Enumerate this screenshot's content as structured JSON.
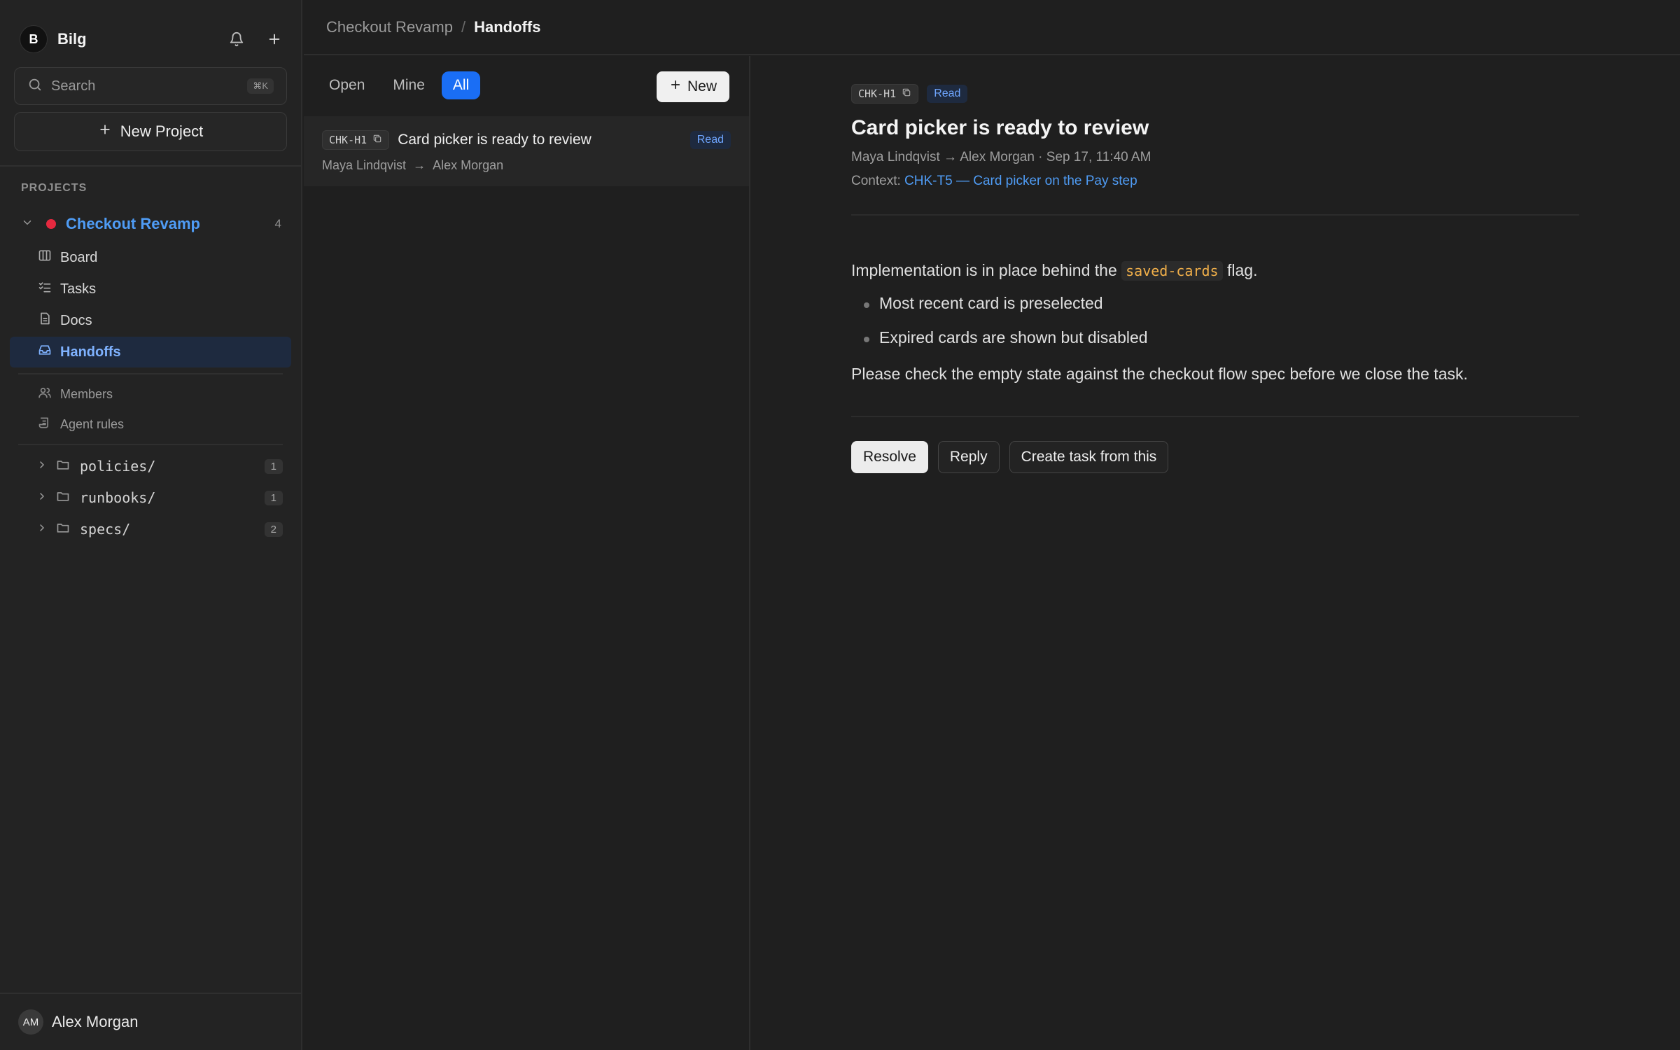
{
  "workspace": {
    "initial": "B",
    "name": "Bilg"
  },
  "search": {
    "placeholder": "Search",
    "shortcut": "⌘K"
  },
  "new_project_label": "New Project",
  "projects_label": "PROJECTS",
  "project": {
    "name": "Checkout Revamp",
    "count": "4",
    "dot_color": "#e5293f"
  },
  "nav": {
    "board": "Board",
    "tasks": "Tasks",
    "docs": "Docs",
    "handoffs": "Handoffs",
    "members": "Members",
    "agent_rules": "Agent rules"
  },
  "folders": [
    {
      "name": "policies/",
      "count": "1"
    },
    {
      "name": "runbooks/",
      "count": "1"
    },
    {
      "name": "specs/",
      "count": "2"
    }
  ],
  "user": {
    "initials": "AM",
    "name": "Alex Morgan"
  },
  "breadcrumb": {
    "parent": "Checkout Revamp",
    "sep": "/",
    "current": "Handoffs"
  },
  "filters": {
    "open": "Open",
    "mine": "Mine",
    "all": "All"
  },
  "new_label": "New",
  "list": [
    {
      "id": "CHK-H1",
      "title": "Card picker is ready to review",
      "status": "Read",
      "from": "Maya Lindqvist",
      "arrow": "→",
      "to": "Alex Morgan"
    }
  ],
  "detail": {
    "id": "CHK-H1",
    "status": "Read",
    "title": "Card picker is ready to review",
    "meta": "Maya Lindqvist → Alex Morgan · Sep 17, 11:40 AM",
    "context_label": "Context:",
    "context_link": "CHK-T5 — Card picker on the Pay step",
    "body_before": "Implementation is in place behind the",
    "body_code": "saved-cards",
    "body_after": "flag.",
    "bullets": [
      "Most recent card is preselected",
      "Expired cards are shown but disabled"
    ],
    "closing": "Please check the empty state against the checkout flow spec before we close the task.",
    "actions": {
      "resolve": "Resolve",
      "reply": "Reply",
      "create_task": "Create task from this"
    }
  },
  "colors": {
    "accent": "#1a6ef5",
    "link": "#4f9cf5",
    "code": "#f3b14a"
  }
}
